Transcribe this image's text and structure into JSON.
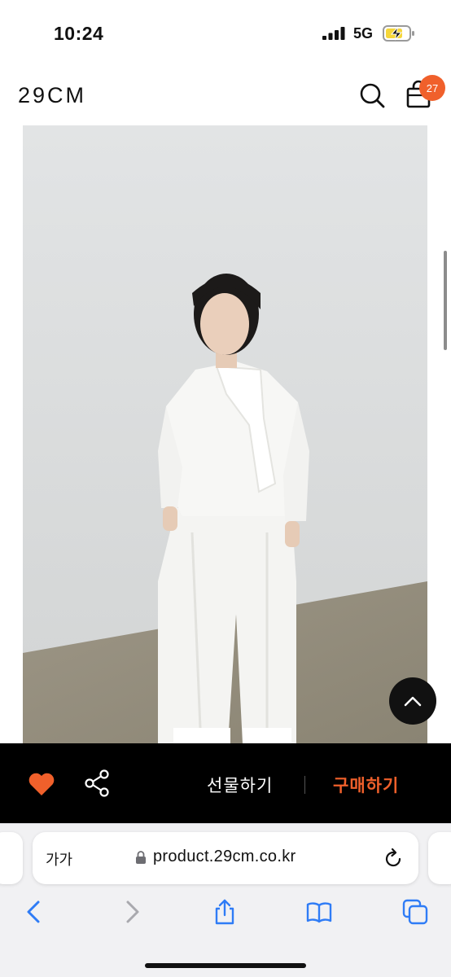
{
  "status_bar": {
    "time": "10:24",
    "network": "5G"
  },
  "header": {
    "logo": "29CM",
    "cart_count": "27"
  },
  "product": {
    "image_icon": "model-photo-white-blouse-and-pants"
  },
  "purchase_bar": {
    "gift_label": "선물하기",
    "buy_label": "구매하기",
    "heart_color": "#f0602b",
    "buy_color": "#f0602b"
  },
  "safari": {
    "text_size_label": "가가",
    "url": "product.29cm.co.kr"
  },
  "colors": {
    "accent": "#f0602b",
    "purchase_bar_bg": "#000000"
  }
}
